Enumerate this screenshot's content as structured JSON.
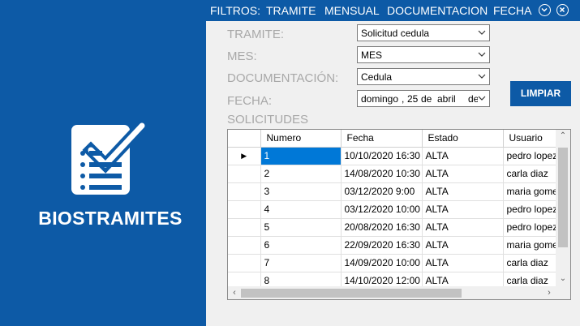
{
  "sidebar": {
    "logo_icon": "checklist-icon",
    "app_name": "BIOSTRAMITES",
    "background": "#0d5aa6"
  },
  "menu": {
    "items": [
      "FILTROS:",
      "TRAMITE",
      "MENSUAL",
      "DOCUMENTACION",
      "FECHA"
    ],
    "minimize_icon": "chevron-down-circle-icon",
    "close_icon": "close-circle-icon"
  },
  "filters": {
    "tramite": {
      "label": "TRAMITE:",
      "value": "Solicitud cedula"
    },
    "mes": {
      "label": "MES:",
      "value": "MES"
    },
    "documentacion": {
      "label": "DOCUMENTACIÓN:",
      "value": "Cedula"
    },
    "fecha": {
      "label": "FECHA:",
      "day_name": "domingo",
      "day": "25",
      "de1": "de",
      "month": "abril",
      "de2": "de"
    }
  },
  "buttons": {
    "limpiar": "LIMPIAR"
  },
  "solicitudes": {
    "title": "SOLICITUDES",
    "columns": [
      "Numero",
      "Fecha",
      "Estado",
      "Usuario"
    ],
    "rows": [
      [
        "1",
        "10/10/2020 16:30",
        "ALTA",
        "pedro lopez"
      ],
      [
        "2",
        "14/08/2020 10:30",
        "ALTA",
        "carla diaz"
      ],
      [
        "3",
        "03/12/2020 9:00",
        "ALTA",
        "maria gomez"
      ],
      [
        "4",
        "03/12/2020 10:00",
        "ALTA",
        "pedro lopez"
      ],
      [
        "5",
        "20/08/2020 16:30",
        "ALTA",
        "pedro lopez"
      ],
      [
        "6",
        "22/09/2020 16:30",
        "ALTA",
        "maria gomez"
      ],
      [
        "7",
        "14/09/2020 10:00",
        "ALTA",
        "carla diaz"
      ],
      [
        "8",
        "14/10/2020 12:00",
        "ALTA",
        "carla diaz"
      ]
    ],
    "selected_row": 1
  },
  "colors": {
    "accent": "#0d5aa6",
    "selection": "#0078d7",
    "label_gray": "#a8a8a8"
  }
}
